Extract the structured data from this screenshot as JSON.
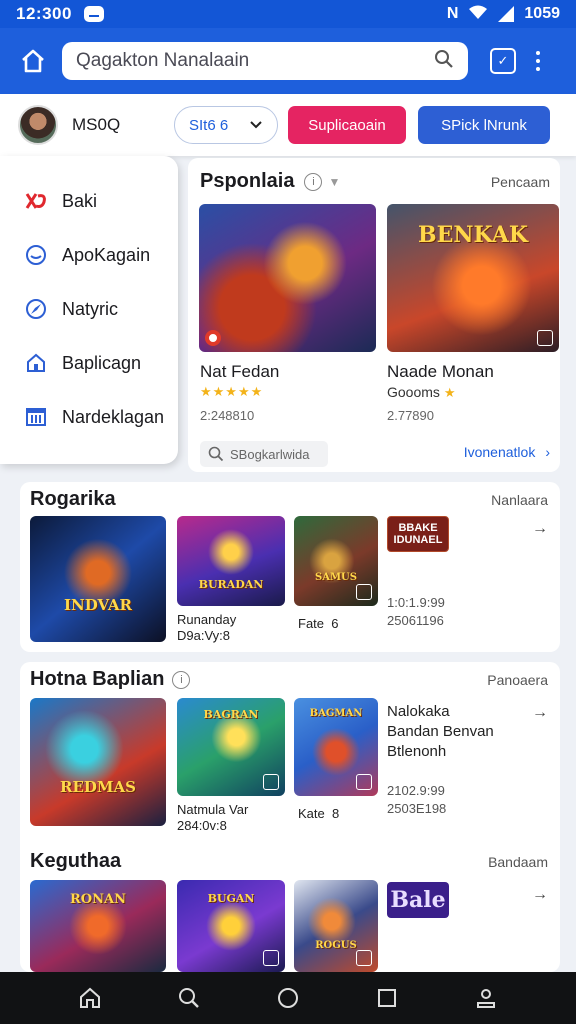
{
  "status": {
    "time": "12:300",
    "right_text": "1059",
    "icons": [
      "messenger-icon",
      "nfc-icon",
      "wifi-icon",
      "signal-icon"
    ]
  },
  "search": {
    "placeholder": "Qagakton Nanalaain"
  },
  "profile": {
    "username": "MS0Q",
    "select_value": "SIt6 6",
    "red_button": "Suplicaoain",
    "blue_button": "SPick lNrunk"
  },
  "sidebar": {
    "items": [
      {
        "label": "Baki",
        "icon": "logo-x-icon"
      },
      {
        "label": "ApoKagain",
        "icon": "smile-icon"
      },
      {
        "label": "Natyric",
        "icon": "compass-icon"
      },
      {
        "label": "Baplicagn",
        "icon": "house-icon"
      },
      {
        "label": "Nardeklagan",
        "icon": "calendar-icon"
      }
    ]
  },
  "featured": {
    "title": "Psponlaia",
    "link": "Pencaam",
    "cards": [
      {
        "name": "Nat Fedan",
        "sub": "★★★★★",
        "count": "2:248810"
      },
      {
        "name": "Naade Monan",
        "sub": "Goooms",
        "count": "2.77890",
        "art_title": "BENKAK"
      }
    ],
    "chip": "SBogkarlwida",
    "more": "Ivonenatlok"
  },
  "sections": [
    {
      "title": "Rogarika",
      "link": "Nanlaara",
      "card_titles": [
        "INDVAR",
        "BURADAN",
        "SAMUS"
      ],
      "tag": "BBAKE IDUNAEL",
      "captions": [
        "Runanday\nD9a:Vy:8",
        "Fate  6"
      ],
      "meta": "1:0:1.9:99\n25061196"
    },
    {
      "title": "Hotna Baplian",
      "link": "Panoaera",
      "card_titles": [
        "REDMAS",
        "BAGRAN",
        "BAGMAN"
      ],
      "tag_text": "Nalokaka\nBandan Benvan\nBtlenonh",
      "captions": [
        "Natmula Var\n284:0v:8",
        "Kate  8"
      ],
      "meta": "2102.9:99\n2503E198"
    },
    {
      "title": "Keguthaa",
      "link": "Bandaam",
      "card_titles": [
        "RONAN",
        "BUGAN",
        "ROGUS"
      ],
      "tag": "Bale"
    }
  ],
  "colors": {
    "primary": "#1e5fdc",
    "accent_red": "#e52462",
    "accent_blue": "#2d5fd4",
    "star": "#f3b31a",
    "navbar": "#111214"
  }
}
